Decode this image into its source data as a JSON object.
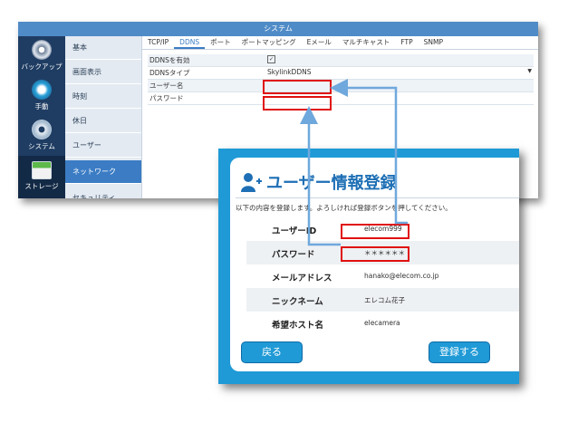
{
  "system_window": {
    "title": "システム",
    "icons": [
      {
        "label": "バックアップ",
        "icon": "backup-icon"
      },
      {
        "label": "手動",
        "icon": "hand-icon"
      },
      {
        "label": "システム",
        "icon": "gear-icon"
      },
      {
        "label": "ストレージ",
        "icon": "storage-icon"
      }
    ],
    "menu": [
      "基本",
      "画面表示",
      "時刻",
      "休日",
      "ユーザー",
      "ネットワーク",
      "セキュリティ"
    ],
    "menu_active": "ネットワーク",
    "tabs": [
      "TCP/IP",
      "DDNS",
      "ポート",
      "ポートマッピング",
      "Eメール",
      "マルチキャスト",
      "FTP",
      "SNMP"
    ],
    "tab_active": "DDNS",
    "ddns_form": {
      "enable_label": "DDNSを有効",
      "enable_value": "✓",
      "type_label": "DDNSタイプ",
      "type_value": "SkylinkDDNS",
      "username_label": "ユーザー名",
      "username_value": "",
      "password_label": "パスワード",
      "password_value": ""
    }
  },
  "registration_dialog": {
    "title": "ユーザー情報登録",
    "instruction": "以下の内容を登録します。よろしければ登録ボタンを押してください。",
    "fields": [
      {
        "label": "ユーザーID",
        "value": "elecom999"
      },
      {
        "label": "パスワード",
        "value": "＊＊＊＊＊＊"
      },
      {
        "label": "メールアドレス",
        "value": "hanako@elecom.co.jp"
      },
      {
        "label": "ニックネーム",
        "value": "エレコム花子"
      },
      {
        "label": "希望ホスト名",
        "value": "elecamera"
      }
    ],
    "back_label": "戻る",
    "register_label": "登録する"
  },
  "colors": {
    "highlight_box": "#e01010",
    "arrow": "#6fa8dc",
    "dialog_frame": "#1f9ad6",
    "title_blue": "#1e6fb5"
  }
}
